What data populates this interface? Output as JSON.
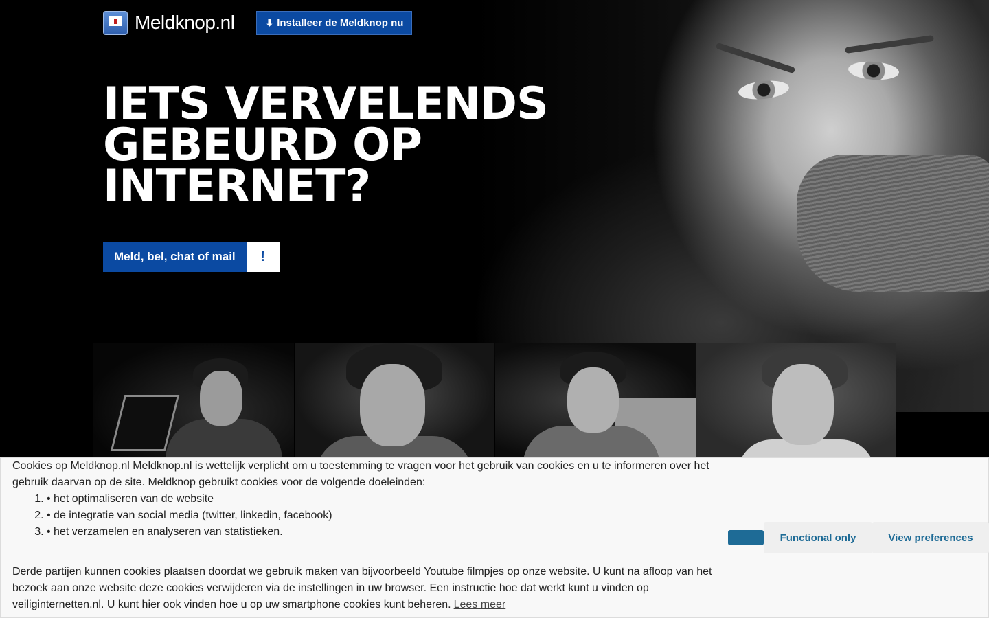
{
  "header": {
    "logo_text": "Meldknop.nl",
    "install_button": "Installeer de Meldknop nu"
  },
  "hero": {
    "headline": [
      "IETS VERVELENDS",
      "GEBEURD OP",
      "INTERNET?"
    ],
    "cta_label": "Meld, bel, chat of mail",
    "cta_icon": "!"
  },
  "cookie_banner": {
    "intro": "Cookies op Meldknop.nl Meldknop.nl is wettelijk verplicht om u toestemming te vragen voor het gebruik van cookies en u te informeren over het gebruik daarvan op de site. Meldknop gebruikt cookies voor de volgende doeleinden:",
    "purposes": [
      "• het optimaliseren van de website",
      "• de integratie van social media (twitter, linkedin, facebook)",
      "• het verzamelen en analyseren van statistieken."
    ],
    "third_party": "Derde partijen kunnen cookies plaatsen doordat we gebruik maken van bijvoorbeeld Youtube filmpjes op onze website. U kunt na afloop van het bezoek aan onze website deze cookies verwijderen via de instellingen in uw browser. Een instructie hoe dat werkt kunt u vinden op veiliginternetten.nl. U kunt hier ook vinden hoe u op uw smartphone cookies kunt beheren.",
    "read_more": "Lees meer",
    "functional_only": "Functional only",
    "view_preferences": "View preferences"
  },
  "colors": {
    "brand_blue": "#0b4aa2",
    "cookie_accent": "#1e6b96"
  }
}
